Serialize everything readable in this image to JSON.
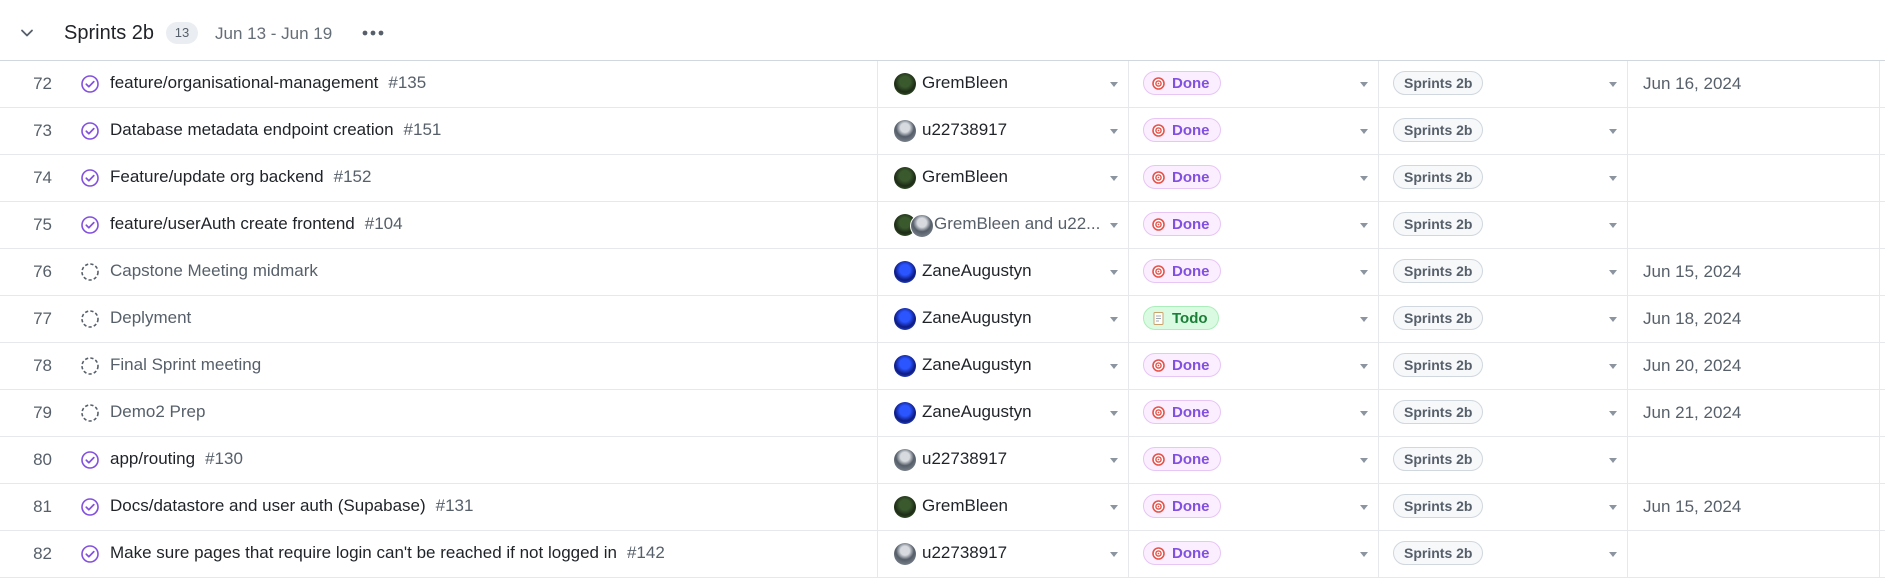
{
  "group": {
    "title": "Sprints 2b",
    "count": "13",
    "dates": "Jun 13 - Jun 19"
  },
  "rows": [
    {
      "num": "72",
      "state": "done",
      "title": "feature/organisational-management",
      "issue": "#135",
      "assignee": "GremBleen",
      "avatar": "grem",
      "status": "Done",
      "iteration": "Sprints 2b",
      "date": "Jun 16, 2024"
    },
    {
      "num": "73",
      "state": "done",
      "title": "Database metadata endpoint creation",
      "issue": "#151",
      "assignee": "u22738917",
      "avatar": "u22",
      "status": "Done",
      "iteration": "Sprints 2b",
      "date": ""
    },
    {
      "num": "74",
      "state": "done",
      "title": "Feature/update org backend",
      "issue": "#152",
      "assignee": "GremBleen",
      "avatar": "grem",
      "status": "Done",
      "iteration": "Sprints 2b",
      "date": ""
    },
    {
      "num": "75",
      "state": "done",
      "title": "feature/userAuth create frontend",
      "issue": "#104",
      "assignee": "GremBleen and u22...",
      "avatar": "multi",
      "status": "Done",
      "iteration": "Sprints 2b",
      "date": ""
    },
    {
      "num": "76",
      "state": "draft",
      "title": "Capstone Meeting midmark",
      "issue": "",
      "assignee": "ZaneAugustyn",
      "avatar": "zane",
      "status": "Done",
      "iteration": "Sprints 2b",
      "date": "Jun 15, 2024"
    },
    {
      "num": "77",
      "state": "draft",
      "title": "Deplyment",
      "issue": "",
      "assignee": "ZaneAugustyn",
      "avatar": "zane",
      "status": "Todo",
      "iteration": "Sprints 2b",
      "date": "Jun 18, 2024"
    },
    {
      "num": "78",
      "state": "draft",
      "title": "Final Sprint meeting",
      "issue": "",
      "assignee": "ZaneAugustyn",
      "avatar": "zane",
      "status": "Done",
      "iteration": "Sprints 2b",
      "date": "Jun 20, 2024"
    },
    {
      "num": "79",
      "state": "draft",
      "title": "Demo2 Prep",
      "issue": "",
      "assignee": "ZaneAugustyn",
      "avatar": "zane",
      "status": "Done",
      "iteration": "Sprints 2b",
      "date": "Jun 21, 2024"
    },
    {
      "num": "80",
      "state": "done",
      "title": "app/routing",
      "issue": "#130",
      "assignee": "u22738917",
      "avatar": "u22",
      "status": "Done",
      "iteration": "Sprints 2b",
      "date": ""
    },
    {
      "num": "81",
      "state": "done",
      "title": "Docs/datastore and user auth (Supabase)",
      "issue": "#131",
      "assignee": "GremBleen",
      "avatar": "grem",
      "status": "Done",
      "iteration": "Sprints 2b",
      "date": "Jun 15, 2024"
    },
    {
      "num": "82",
      "state": "done",
      "title": "Make sure pages that require login can't be reached if not logged in",
      "issue": "#142",
      "assignee": "u22738917",
      "avatar": "u22",
      "status": "Done",
      "iteration": "Sprints 2b",
      "date": ""
    }
  ],
  "colors": {
    "done_accent": "#8250df",
    "todo_accent": "#1a7f37",
    "target_icon": "#e5534b"
  }
}
